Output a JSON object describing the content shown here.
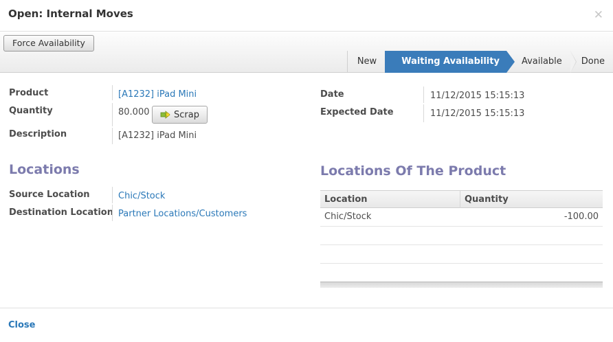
{
  "dialog": {
    "title": "Open: Internal Moves",
    "close_icon": "close-icon",
    "footer_close_label": "Close"
  },
  "toolbar": {
    "force_availability_label": "Force Availability"
  },
  "statusbar": {
    "stages": [
      {
        "label": "New",
        "active": false
      },
      {
        "label": "Waiting Availability",
        "active": true
      },
      {
        "label": "Available",
        "active": false
      },
      {
        "label": "Done",
        "active": false
      }
    ]
  },
  "form": {
    "product_label": "Product",
    "product_value": "[A1232] iPad Mini",
    "quantity_label": "Quantity",
    "quantity_value": "80.000",
    "scrap_label": "Scrap",
    "scrap_icon": "scrap-icon",
    "description_label": "Description",
    "description_value": "[A1232] iPad Mini",
    "date_label": "Date",
    "date_value": "11/12/2015 15:15:13",
    "expected_date_label": "Expected Date",
    "expected_date_value": "11/12/2015 15:15:13"
  },
  "locations": {
    "title": "Locations",
    "source_label": "Source Location",
    "source_value": "Chic/Stock",
    "destination_label": "Destination Location",
    "destination_value": "Partner Locations/Customers"
  },
  "product_locations": {
    "title": "Locations Of The Product",
    "columns": [
      "Location",
      "Quantity"
    ],
    "rows": [
      {
        "location": "Chic/Stock",
        "quantity": "-100.00"
      }
    ]
  },
  "colors": {
    "accent": "#3a7cba",
    "link": "#2a78b8",
    "section_title": "#7c7bad"
  }
}
